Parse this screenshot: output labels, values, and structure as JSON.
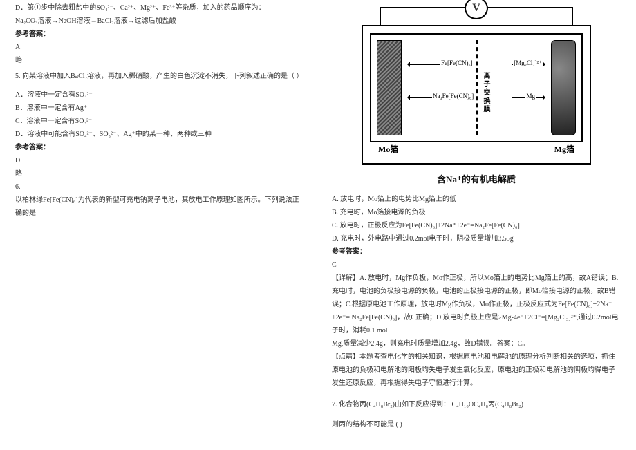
{
  "left": {
    "d_text": "D．第①步中除去粗盐中的SO₄²⁻、Ca²⁺、Mg²⁺、Fe³⁺等杂质，加入的药品顺序为：",
    "d_text2": "Na₂CO₃溶液→NaOH溶液→BaCl₂溶液→过滤后加盐酸",
    "ans_label": "参考答案：",
    "ans_a": "A",
    "skip": "略",
    "q5": "5. 向某溶液中加入BaCl₂溶液，再加入稀硝酸，产生的白色沉淀不消失，下列叙述正确的是（    ）",
    "opt_a": "A．溶液中一定含有SO₄²⁻",
    "opt_b": "B．溶液中一定含有Ag⁺",
    "opt_c": "C．溶液中一定含有SO₃²⁻",
    "opt_d": "D．溶液中可能含有SO₄²⁻、SO₃²⁻、Ag⁺中的某一种、两种或三种",
    "ans_d": "D",
    "q6_num": "6.",
    "q6_text": "以柏林绿Fe[Fe(CN)₆]为代表的新型可充电钠离子电池，其放电工作原理如图所示。下列说法正确的是"
  },
  "fig": {
    "volt": "V",
    "lab_fe": "Fe[Fe(CN)₆]",
    "lab_mgcl": "[Mg₂Cl₃]²⁺",
    "lab_na3": "Na₃Fe[Fe(CN)₆]",
    "lab_mg": "Mg",
    "membrane": "离子交换膜",
    "foil_l": "Mo箔",
    "foil_r": "Mg箔",
    "electrolyte": "含Na⁺的有机电解质"
  },
  "right": {
    "opt_a": "A. 放电时，Mo箔上的电势比Mg箔上的低",
    "opt_b": "B. 充电时，Mo箔接电源的负极",
    "opt_c": "C. 放电时，正极反应为Fe[Fe(CN)₆]+2Na⁺+2e⁻=Na₂Fe[Fe(CN)₆]",
    "opt_d": "D. 充电时，外电路中通过0.2mol电子时，阴极质量增加3.55g",
    "ans_label": "参考答案：",
    "ans": "C",
    "detail_label": "【详解】A.",
    "detail": "放电时，Mg作负极，Mo作正极，所以Mo箔上的电势比Mg箔上的高，故A错误；B.充电时，电池的负极接电源的负极，电池的正极接电源的正极，即Mo箔接电源的正极，故B错误；C.根据原电池工作原理，放电时Mg作负极，Mo作正极，正极反应式为Fe[Fe(CN)₆]+2Na⁺ +2e⁻= Na₂Fe[Fe(CN)₆]，故C正确；D.放电时负极上应是2Mg-4e⁻+2Cl⁻=[Mg₂Cl₃]²⁺,通过0.2mol电子时，消耗0.1 mol",
    "detail2": "Mg,质量减少2.4g，则充电时质量增加2.4g，故D错误。答案：C。",
    "point_label": "【点睛】",
    "point": "本题考查电化学的相关知识，根据原电池和电解池的原理分析判断相关的选项，抓住原电池的负极和电解池的阳极均失电子发生氧化反应，原电池的正极和电解池的阴极均得电子发生还原反应，再根据得失电子守恒进行计算。",
    "q7": "7. 化合物丙(C₄H₈Br₂)由如下反应得到：  C₄H₁₀OC₄H₈丙(C₄H₈Br₂)",
    "q7b": "则丙的结构不可能是         (      )"
  }
}
